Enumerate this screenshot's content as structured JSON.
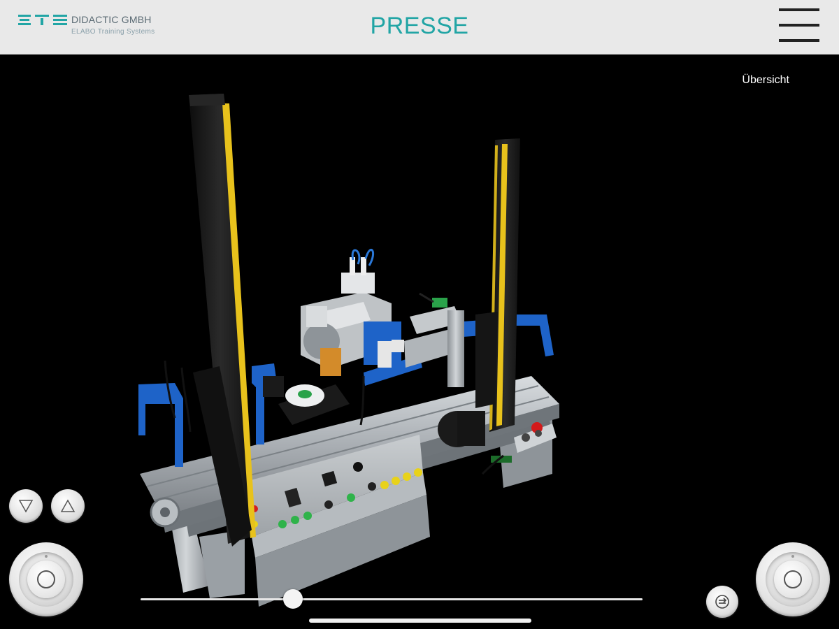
{
  "header": {
    "logo": {
      "mark": "ETS",
      "company": "DIDACTIC GMBH",
      "subtitle": "ELABO Training Systems"
    },
    "title": "PRESSE",
    "menu_icon": "hamburger-menu-icon"
  },
  "viewport": {
    "overview_label": "Übersicht",
    "model": "press-station-3d-model"
  },
  "controls": {
    "down_icon": "triangle-down-icon",
    "up_icon": "triangle-up-icon",
    "left_joystick_icon": "joystick-icon",
    "right_joystick_icon": "joystick-icon",
    "reset_icon": "reset-view-icon",
    "slider_value_fraction": 0.303
  },
  "colors": {
    "accent": "#22a5a5",
    "header_bg": "#e9e9e9",
    "background": "#000000",
    "safety_yellow": "#e8c21c",
    "profile_blue": "#1e63c8"
  }
}
